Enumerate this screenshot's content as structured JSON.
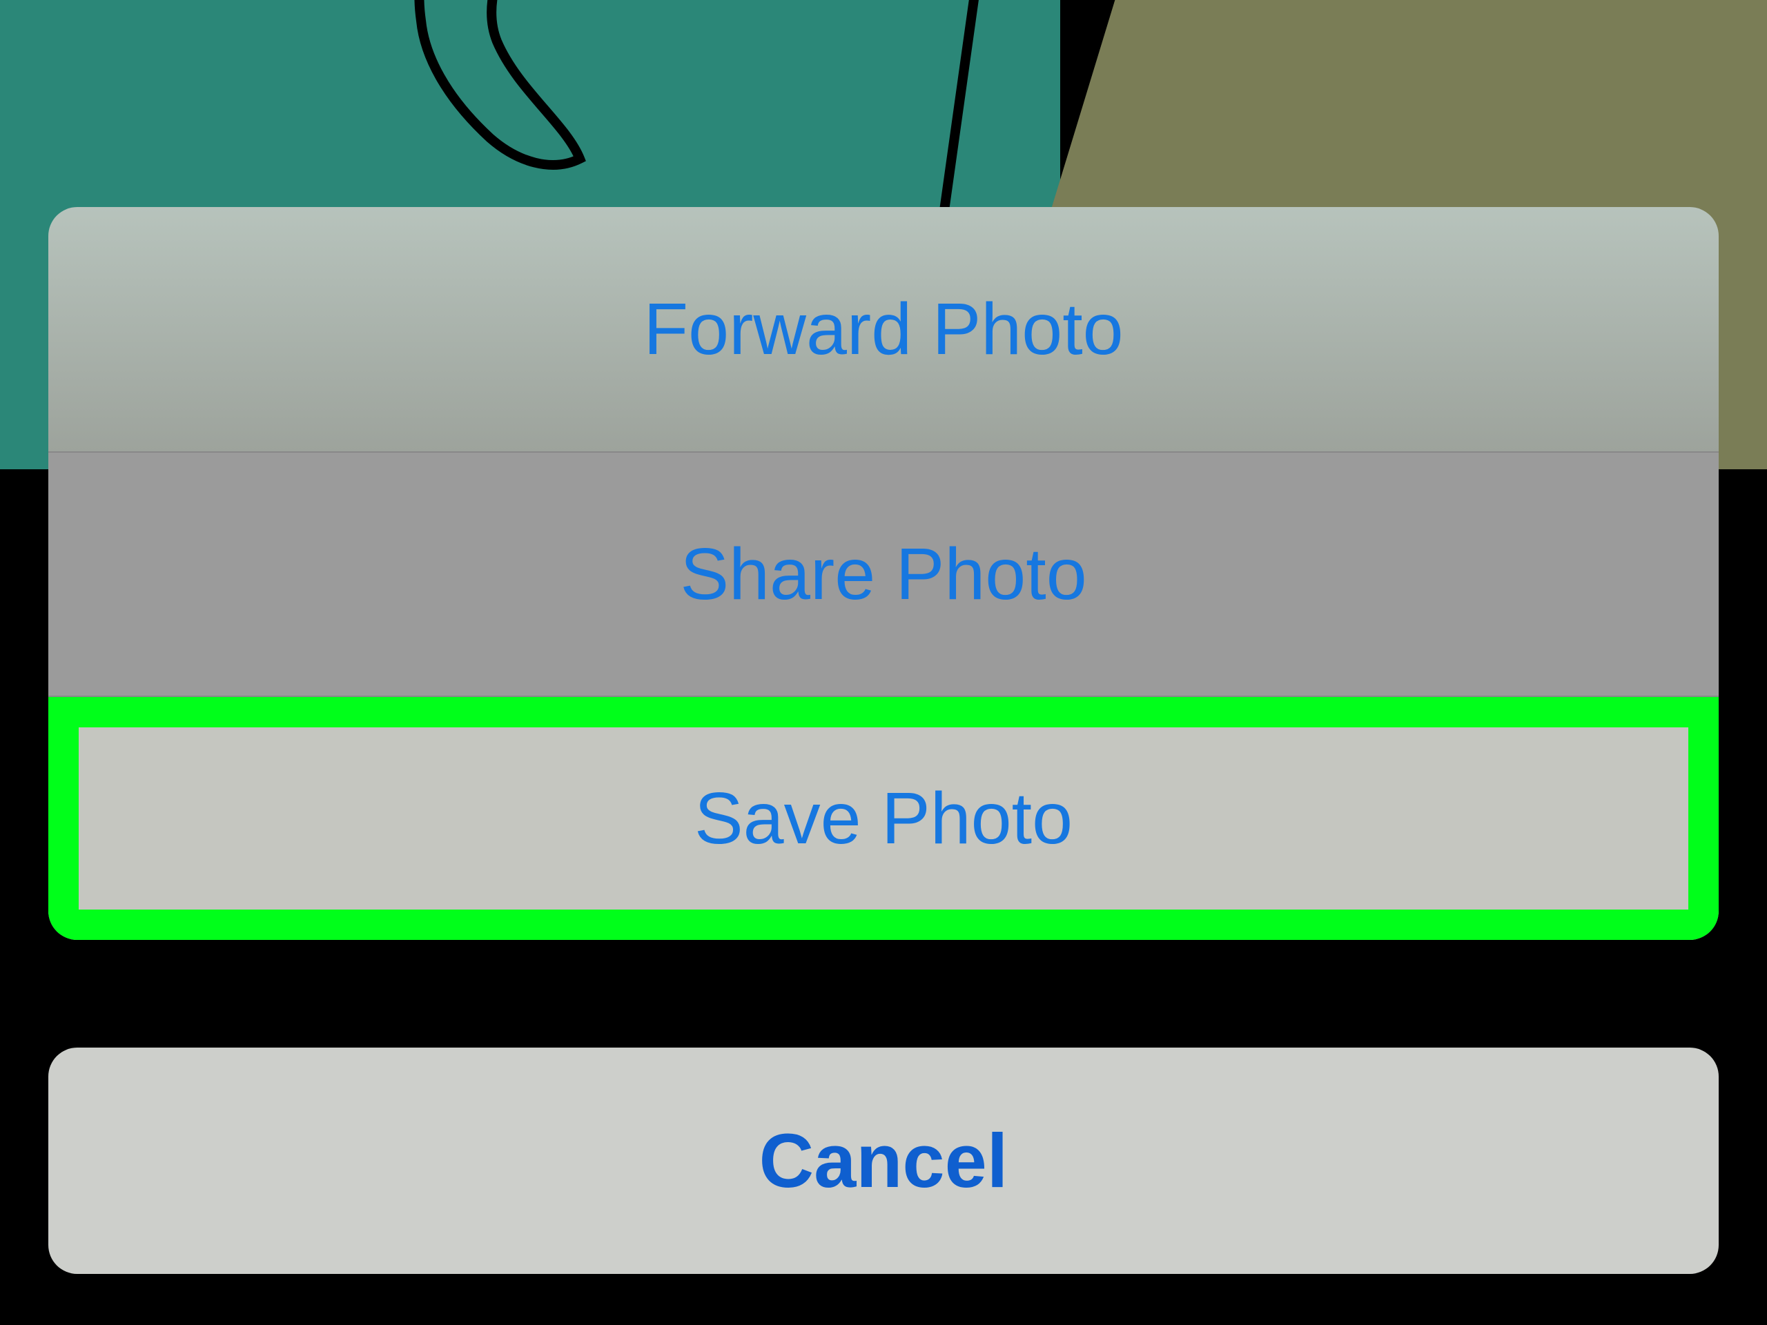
{
  "actionSheet": {
    "options": {
      "forward": "Forward Photo",
      "share": "Share Photo",
      "save": "Save Photo"
    },
    "cancel": "Cancel",
    "highlightColor": "#00ff1a",
    "accentColor": "#1677e0"
  }
}
